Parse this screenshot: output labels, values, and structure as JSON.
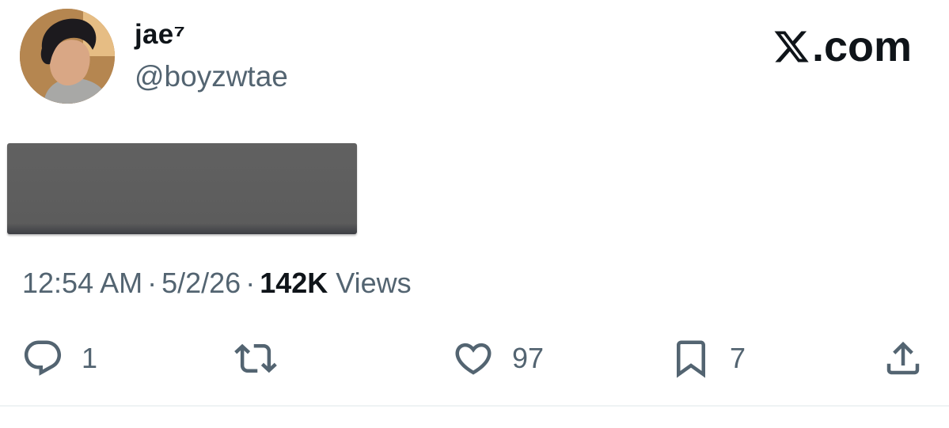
{
  "tweet": {
    "author": {
      "display_name": "jae⁷",
      "handle": "@boyzwtae",
      "avatar_icon": "profile-photo"
    },
    "brand": {
      "text": "com",
      "logo_icon": "x-logo-icon",
      "label": "𝕏.com"
    },
    "content": {
      "redacted": true,
      "redaction_color": "#5f5f5f"
    },
    "meta": {
      "time": "12:54 AM",
      "separator": "·",
      "date": "5/2/26",
      "views_count": "142K",
      "views_label": "Views"
    },
    "actions": {
      "reply": {
        "icon": "reply-icon",
        "count": "1"
      },
      "retweet": {
        "icon": "retweet-icon",
        "count": ""
      },
      "like": {
        "icon": "heart-icon",
        "count": "97"
      },
      "bookmark": {
        "icon": "bookmark-icon",
        "count": "7"
      },
      "share": {
        "icon": "share-icon",
        "count": ""
      }
    }
  },
  "colors": {
    "primary_text": "#0f1419",
    "secondary_text": "#536471",
    "divider": "#eff3f4"
  }
}
